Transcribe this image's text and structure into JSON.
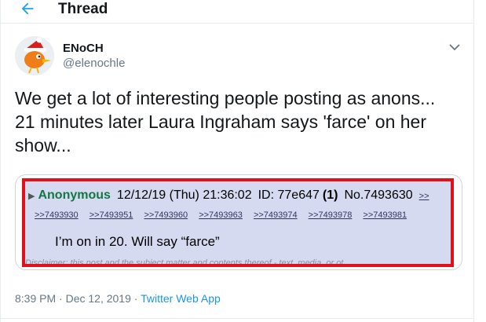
{
  "header": {
    "title": "Thread",
    "back_icon": "arrow-left-icon",
    "accent_color": "#1da1f2"
  },
  "tweet": {
    "author": {
      "display_name": "ENoCH",
      "handle": "@elenochle",
      "avatar_icon": "santa-bird-avatar"
    },
    "text_line_1": "We get a lot of interesting people posting as anons...",
    "text_line_2": "21 minutes later Laura Ingraham says 'farce' on her",
    "text_line_3": "show...",
    "media": {
      "post": {
        "name": "Anonymous",
        "datetime": "12/12/19 (Thu) 21:36:02",
        "id_label": "ID: 77e647",
        "id_count": "(1)",
        "post_number": "No.7493630",
        "post_link": ">>",
        "replies": [
          ">>7493930",
          ">>7493951",
          ">>7493960",
          ">>7493963",
          ">>7493974",
          ">>7493978",
          ">>7493981"
        ],
        "message": "I’m on in 20.  Will say “farce”",
        "disclaimer": "Disclaimer: this post and the subject matter and contents thereof - text, media, or ot"
      },
      "highlight_color": "#e0111b",
      "post_background": "#d6daf0",
      "name_color": "#117743"
    },
    "meta": {
      "time": "8:39 PM",
      "separator": " · ",
      "date": "Dec 12, 2019",
      "source": "Twitter Web App"
    }
  }
}
